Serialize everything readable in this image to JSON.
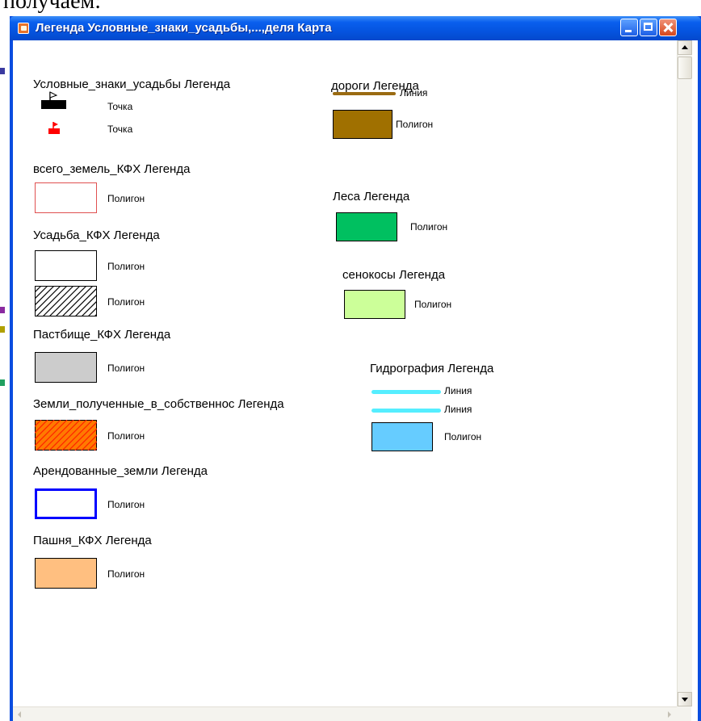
{
  "page": {
    "top_text": "получаем:"
  },
  "window": {
    "title": "Легенда Условные_знаки_усадьбы,...,деля Карта",
    "buttons": [
      "minimize",
      "maximize",
      "close"
    ]
  },
  "legends_left": [
    {
      "title": "Условные_знаки_усадьбы Легенда",
      "items": [
        {
          "kind": "point",
          "icon": "flag-point-black-icon",
          "label": "Точка"
        },
        {
          "kind": "point",
          "icon": "flag-point-red-icon",
          "label": "Точка"
        }
      ]
    },
    {
      "title": "всего_земель_КФХ Легенда",
      "items": [
        {
          "kind": "polygon",
          "fill": "#ffffff",
          "stroke": "#e05050",
          "label": "Полигон"
        }
      ]
    },
    {
      "title": "Усадьба_КФХ Легенда",
      "items": [
        {
          "kind": "polygon",
          "fill": "#ffffff",
          "stroke": "#000000",
          "label": "Полигон"
        },
        {
          "kind": "polygon",
          "fill": "hatch",
          "hatch": "#000000",
          "stroke": "#000000",
          "label": "Полигон"
        }
      ]
    },
    {
      "title": "Пастбище_КФХ Легенда",
      "items": [
        {
          "kind": "polygon",
          "fill": "#cccccc",
          "stroke": "#000000",
          "label": "Полигон"
        }
      ]
    },
    {
      "title": "Земли_полученные_в_собственнос Легенда",
      "items": [
        {
          "kind": "polygon",
          "fill": "hatch",
          "hatch_bg": "#ff7a00",
          "hatch": "#ff2000",
          "stroke": "#000000",
          "label": "Полигон"
        }
      ]
    },
    {
      "title": "Арендованные_земли Легенда",
      "items": [
        {
          "kind": "polygon",
          "fill": "#ffffff",
          "stroke": "#0000ff",
          "label": "Полигон"
        }
      ]
    },
    {
      "title": "Пашня_КФХ Легенда",
      "items": [
        {
          "kind": "polygon",
          "fill": "#ffbf80",
          "stroke": "#000000",
          "label": "Полигон"
        }
      ]
    }
  ],
  "legends_right": [
    {
      "title": "дороги Легенда",
      "items": [
        {
          "kind": "line",
          "color": "#9a6b12",
          "label": "Линия"
        },
        {
          "kind": "polygon",
          "fill": "#a07000",
          "stroke": "#000000",
          "label": "Полигон"
        }
      ]
    },
    {
      "title": "Леса Легенда",
      "items": [
        {
          "kind": "polygon",
          "fill": "#00c060",
          "stroke": "#000000",
          "label": "Полигон"
        }
      ]
    },
    {
      "title": "сенокосы Легенда",
      "items": [
        {
          "kind": "polygon",
          "fill": "#ccff99",
          "stroke": "#000000",
          "label": "Полигон"
        }
      ]
    },
    {
      "title": "Гидрография Легенда",
      "items": [
        {
          "kind": "line",
          "color": "#55eeff",
          "label": "Линия"
        },
        {
          "kind": "line",
          "color": "#55eeff",
          "label": "Линия"
        },
        {
          "kind": "polygon",
          "fill": "#66ccff",
          "stroke": "#000000",
          "label": "Полигон"
        }
      ]
    }
  ]
}
